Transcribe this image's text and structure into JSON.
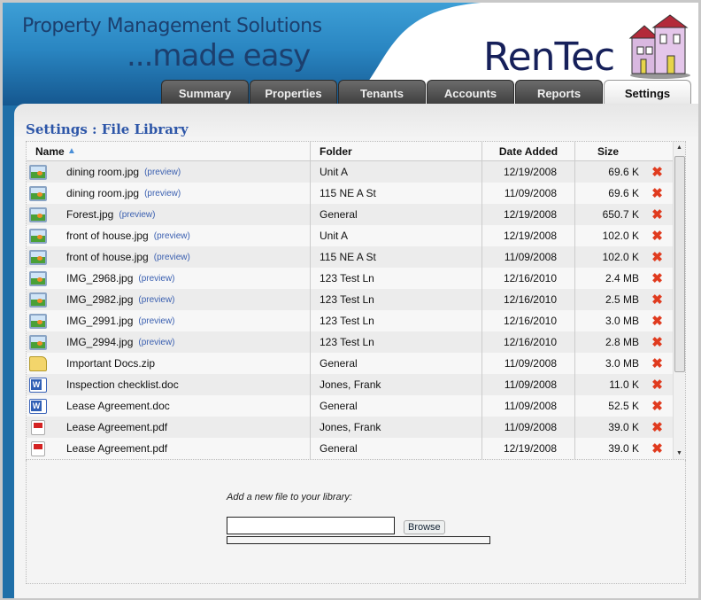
{
  "header": {
    "tagline_line1": "Property Management Solutions",
    "tagline_line2": "...made easy",
    "logo": "RenTec"
  },
  "tabs": [
    {
      "label": "Summary"
    },
    {
      "label": "Properties"
    },
    {
      "label": "Tenants"
    },
    {
      "label": "Accounts"
    },
    {
      "label": "Reports"
    },
    {
      "label": "Settings",
      "active": true
    }
  ],
  "page_title": "Settings : File Library",
  "table": {
    "columns": {
      "name": "Name",
      "folder": "Folder",
      "date": "Date Added",
      "size": "Size"
    },
    "preview_label": "(preview)",
    "rows": [
      {
        "icon": "image",
        "name": "dining room.jpg",
        "preview": true,
        "folder": "Unit A",
        "date": "12/19/2008",
        "size": "69.6 K"
      },
      {
        "icon": "image",
        "name": "dining room.jpg",
        "preview": true,
        "folder": "115 NE A St",
        "date": "11/09/2008",
        "size": "69.6 K"
      },
      {
        "icon": "image",
        "name": "Forest.jpg",
        "preview": true,
        "folder": "General",
        "date": "12/19/2008",
        "size": "650.7 K"
      },
      {
        "icon": "image",
        "name": "front of house.jpg",
        "preview": true,
        "folder": "Unit A",
        "date": "12/19/2008",
        "size": "102.0 K"
      },
      {
        "icon": "image",
        "name": "front of house.jpg",
        "preview": true,
        "folder": "115 NE A St",
        "date": "11/09/2008",
        "size": "102.0 K"
      },
      {
        "icon": "image",
        "name": "IMG_2968.jpg",
        "preview": true,
        "folder": "123 Test Ln",
        "date": "12/16/2010",
        "size": "2.4 MB"
      },
      {
        "icon": "image",
        "name": "IMG_2982.jpg",
        "preview": true,
        "folder": "123 Test Ln",
        "date": "12/16/2010",
        "size": "2.5 MB"
      },
      {
        "icon": "image",
        "name": "IMG_2991.jpg",
        "preview": true,
        "folder": "123 Test Ln",
        "date": "12/16/2010",
        "size": "3.0 MB"
      },
      {
        "icon": "image",
        "name": "IMG_2994.jpg",
        "preview": true,
        "folder": "123 Test Ln",
        "date": "12/16/2010",
        "size": "2.8 MB"
      },
      {
        "icon": "zip",
        "name": "Important Docs.zip",
        "preview": false,
        "folder": "General",
        "date": "11/09/2008",
        "size": "3.0 MB"
      },
      {
        "icon": "doc",
        "name": "Inspection checklist.doc",
        "preview": false,
        "folder": "Jones, Frank",
        "date": "11/09/2008",
        "size": "11.0 K"
      },
      {
        "icon": "doc",
        "name": "Lease Agreement.doc",
        "preview": false,
        "folder": "General",
        "date": "11/09/2008",
        "size": "52.5 K"
      },
      {
        "icon": "pdf",
        "name": "Lease Agreement.pdf",
        "preview": false,
        "folder": "Jones, Frank",
        "date": "11/09/2008",
        "size": "39.0 K"
      },
      {
        "icon": "pdf",
        "name": "Lease Agreement.pdf",
        "preview": false,
        "folder": "General",
        "date": "12/19/2008",
        "size": "39.0 K"
      }
    ]
  },
  "upload": {
    "label": "Add a new file to your library:",
    "file_value": "",
    "browse_label": "Browse"
  }
}
